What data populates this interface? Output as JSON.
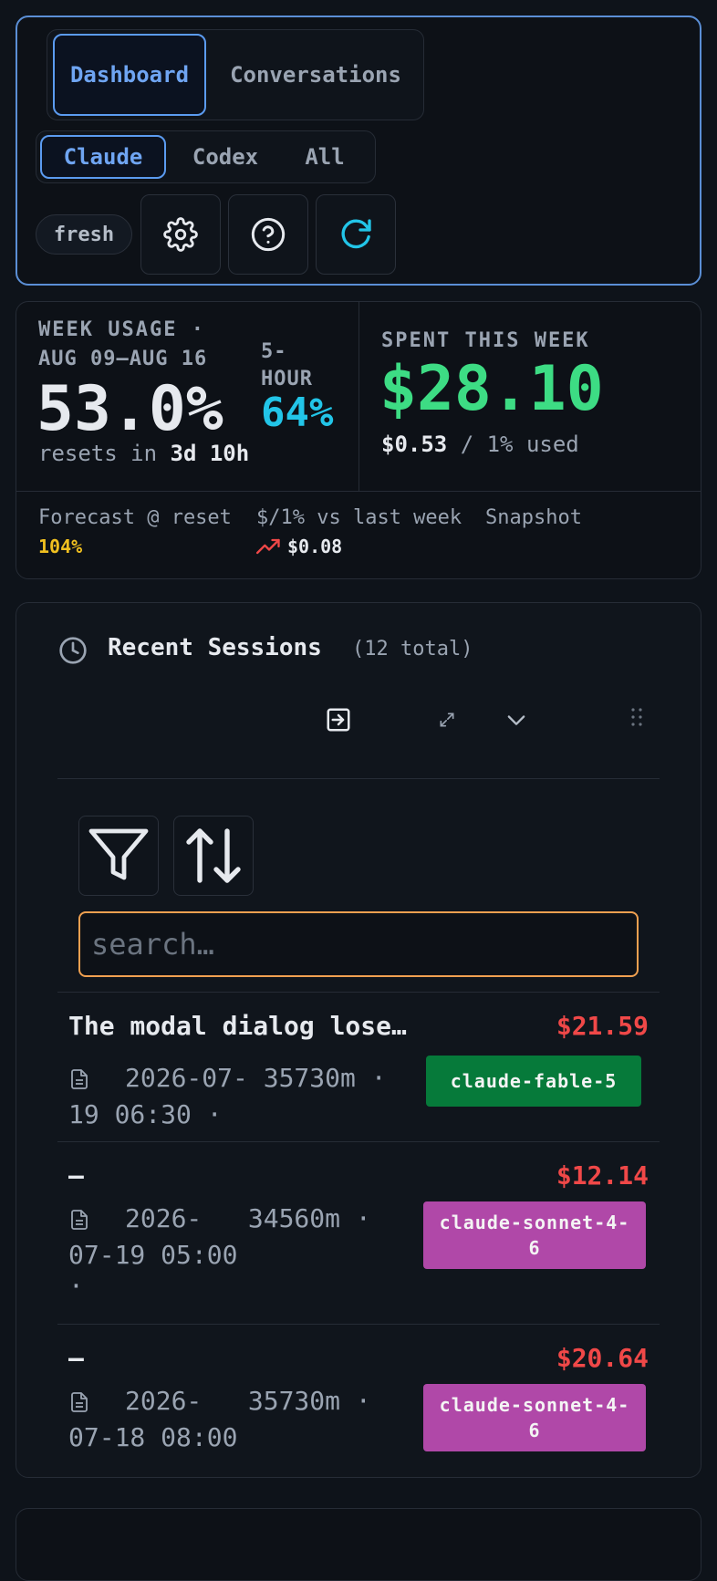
{
  "tabs": {
    "view": [
      {
        "label": "Dashboard"
      },
      {
        "label": "Conversations"
      }
    ],
    "active_view": 0
  },
  "providers": [
    {
      "label": "Claude"
    },
    {
      "label": "Codex"
    },
    {
      "label": "All"
    }
  ],
  "status": {
    "fresh": "fresh"
  },
  "usage": {
    "week_label_1": "WEEK USAGE ·",
    "week_label_2": "AUG 09–AUG 16",
    "week_percent": "53.0%",
    "resets_prefix": "resets in",
    "resets_value": "3d 10h",
    "hour_label_1": "5-",
    "hour_label_2": "HOUR",
    "hour_percent": "64%",
    "spent_label": "SPENT THIS WEEK",
    "spent_value": "$28.10",
    "per_percent": "$0.53",
    "per_suffix": "/ 1% used",
    "forecast_label": "Forecast @ reset",
    "forecast_value": "104%",
    "compare_label": "$/1% vs last week",
    "compare_value": "$0.08",
    "snapshot_label": "Snapshot"
  },
  "colors": {
    "accent": "#5b9bf0",
    "green": "#3ddc84",
    "cyan": "#22c5e8",
    "yellow": "#f0c020",
    "red": "#f04848"
  },
  "sessions": {
    "title": "Recent Sessions",
    "count": "(12 total)",
    "search_placeholder": "search…",
    "rows": [
      {
        "title": "The modal dialog lose…",
        "cost": "$21.59",
        "meta_1": "2026-07- 35730m ·",
        "meta_2": "19 06:30 ·",
        "meta_3": "",
        "model": "claude-fable-5",
        "model_color": "#067a3a"
      },
      {
        "title": "—",
        "cost": "$12.14",
        "meta_1": "2026-   34560m ·",
        "meta_2": "07-19 05:00",
        "meta_3": "·",
        "model": "claude-sonnet-4-6",
        "model_color": "#b048a8"
      },
      {
        "title": "—",
        "cost": "$20.64",
        "meta_1": "2026-   35730m ·",
        "meta_2": "07-18 08:00",
        "meta_3": "",
        "model": "claude-sonnet-4-6",
        "model_color": "#b048a8"
      }
    ]
  }
}
